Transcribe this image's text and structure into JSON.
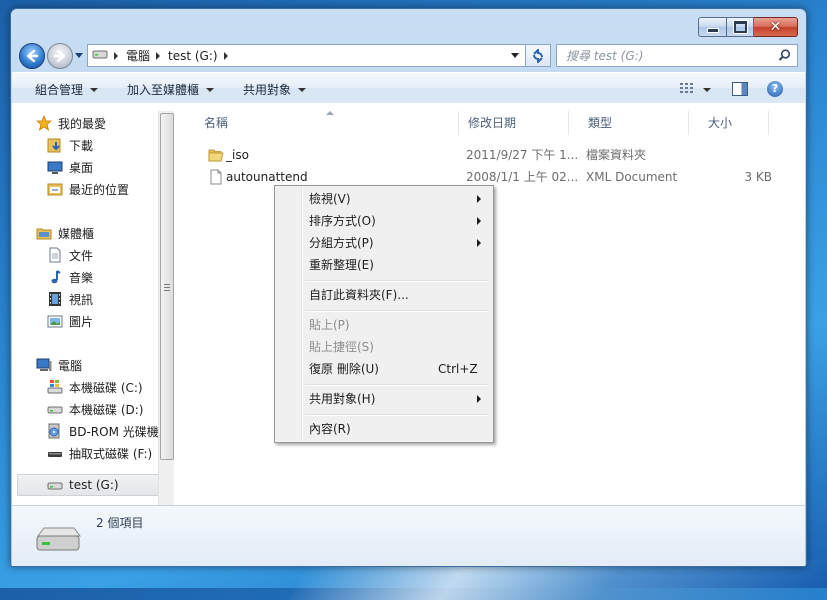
{
  "window": {
    "caption": {
      "close_glyph": "✕"
    }
  },
  "address": {
    "crumbs": [
      "電腦",
      "test (G:)"
    ]
  },
  "search": {
    "placeholder": "搜尋 test (G:)"
  },
  "toolbar": {
    "organize": "組合管理",
    "include_library": "加入至媒體櫃",
    "share": "共用對象",
    "help": "?"
  },
  "sidebar": {
    "favorites": {
      "label": "我的最愛",
      "items": [
        "下載",
        "桌面",
        "最近的位置"
      ]
    },
    "libraries": {
      "label": "媒體櫃",
      "items": [
        "文件",
        "音樂",
        "視訊",
        "圖片"
      ]
    },
    "computer": {
      "label": "電腦",
      "items": [
        "本機磁碟 (C:)",
        "本機磁碟 (D:)",
        "BD-ROM 光碟機",
        "抽取式磁碟 (F:)",
        "test (G:)"
      ]
    },
    "selected": "test (G:)"
  },
  "columns": [
    "名稱",
    "修改日期",
    "類型",
    "大小"
  ],
  "files": [
    {
      "name": "_iso",
      "date": "2011/9/27 下午 1...",
      "type": "檔案資料夾",
      "size": ""
    },
    {
      "name": "autounattend",
      "date": "2008/1/1 上午 02...",
      "type": "XML Document",
      "size": "3 KB"
    }
  ],
  "details": {
    "count": "2 個項目"
  },
  "context_menu": {
    "view": "檢視(V)",
    "sort": "排序方式(O)",
    "group": "分組方式(P)",
    "refresh": "重新整理(E)",
    "customize": "自訂此資料夾(F)...",
    "paste": "貼上(P)",
    "paste_shortcut": "貼上捷徑(S)",
    "undo": "復原 刪除(U)",
    "undo_shortcut": "Ctrl+Z",
    "share": "共用對象(H)",
    "properties": "內容(R)"
  },
  "colors": {
    "accent": "#3a6ea5",
    "folder": "#e8c15a",
    "disabled_text": "#8d8d8d"
  }
}
